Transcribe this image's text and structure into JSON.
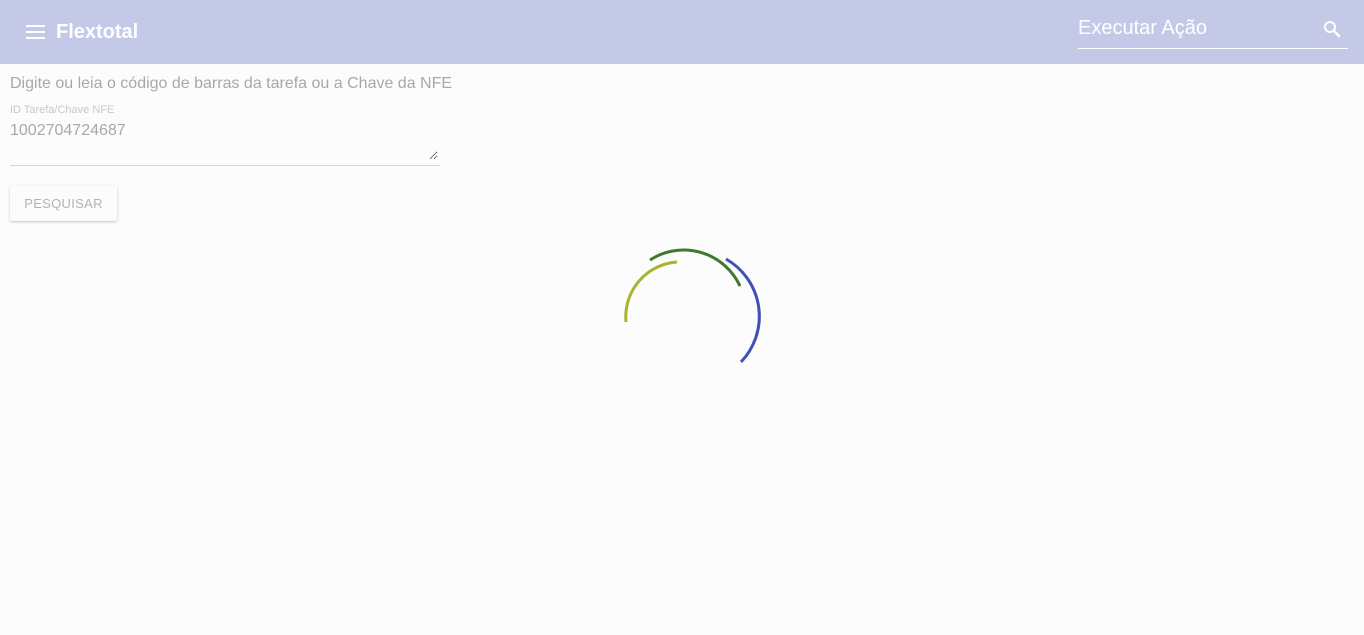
{
  "header": {
    "menu_icon": "hamburger-menu-icon",
    "title": "Flextotal",
    "action_placeholder": "Executar Ação",
    "action_value": "",
    "search_icon": "search-icon",
    "background_color": "#c5c9e8"
  },
  "main": {
    "instructions": "Digite ou leia o código de barras da tarefa ou a Chave da NFE",
    "field": {
      "label": "ID Tarefa/Chave NFE",
      "value": "1002704724687"
    },
    "search_button_label": "PESQUISAR"
  },
  "loading": {
    "icon": "loading-spinner-icon",
    "colors": [
      "#a8b330",
      "#3f7a2c",
      "#3f51b5"
    ]
  }
}
